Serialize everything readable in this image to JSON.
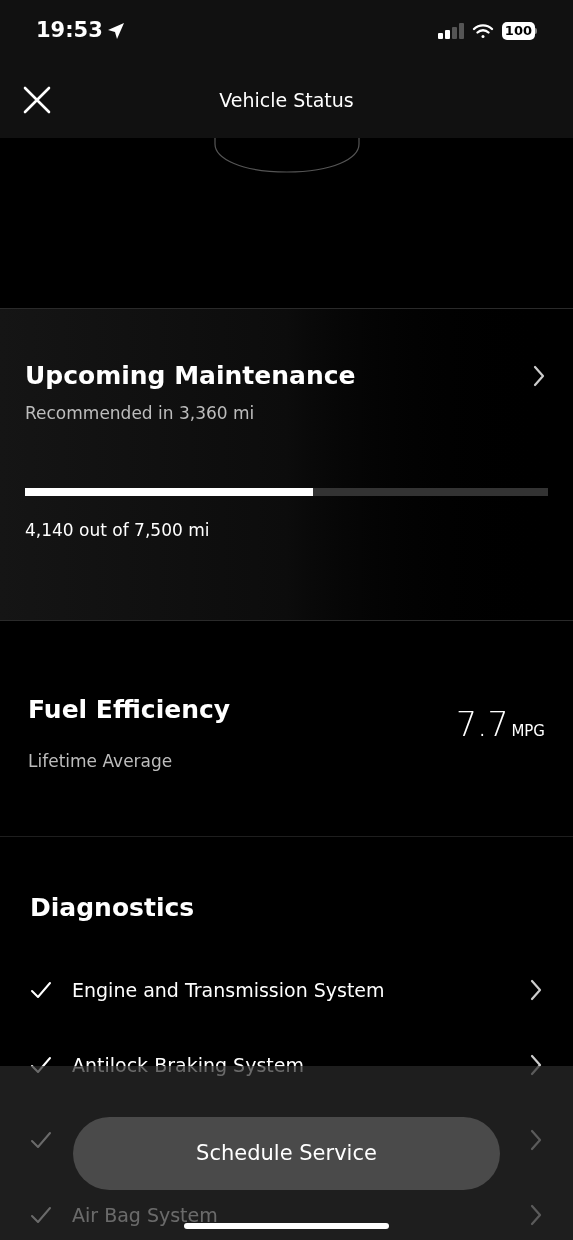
{
  "status_bar": {
    "time": "19:53",
    "battery": "100"
  },
  "header": {
    "title": "Vehicle Status"
  },
  "maintenance": {
    "title": "Upcoming Maintenance",
    "subtitle": "Recommended in 3,360 mi",
    "level": 0.55,
    "reading": "4,140 out of 7,500 mi"
  },
  "fuel": {
    "title": "Fuel Efficiency",
    "subtitle": "Lifetime Average",
    "value": "7.7",
    "unit": "MPG"
  },
  "diagnostics": {
    "title": "Diagnostics",
    "items": [
      {
        "label": "Engine and Transmission System",
        "checked": true
      },
      {
        "label": "Antilock Braking System",
        "checked": true
      },
      {
        "checked": true
      },
      {
        "label": "Air Bag System",
        "checked": true
      }
    ]
  },
  "action": {
    "label": "Schedule Service"
  }
}
